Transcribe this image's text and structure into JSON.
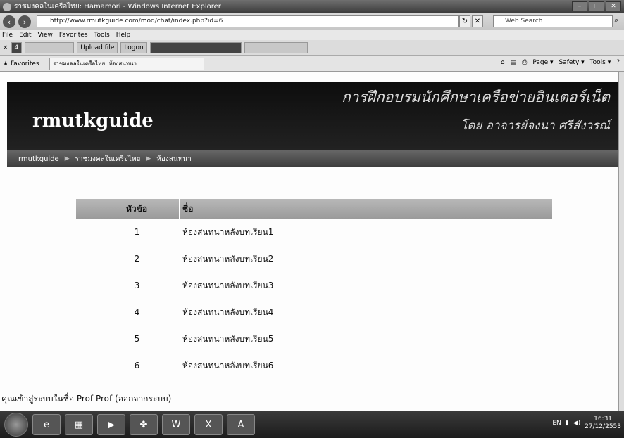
{
  "window": {
    "title": "ราชมงคลในเครือไทย: Hamamori - Windows Internet Explorer",
    "buttons": [
      "–",
      "□",
      "✕"
    ]
  },
  "address": {
    "url": "http://www.rmutkguide.com/mod/chat/index.php?id=6",
    "search_placeholder": "Web Search"
  },
  "menu": [
    "File",
    "Edit",
    "View",
    "Favorites",
    "Tools",
    "Help"
  ],
  "toolbar": {
    "counter": "4",
    "items": [
      "Upload file",
      "Logon"
    ]
  },
  "favorites": {
    "label": "Favorites",
    "tab": "ราชมงคลในเครือไทย: ห้องสนทนา",
    "commands": [
      "Page ▾",
      "Safety ▾",
      "Tools ▾"
    ]
  },
  "banner": {
    "logo": "rmutkguide",
    "heading": "การฝึกอบรมนักศึกษาเครือข่ายอินเตอร์เน็ต",
    "author": "โดย อาจารย์จงนา ศรีสังวรณ์"
  },
  "breadcrumb": [
    "rmutkguide",
    "ราชมงคลในเครือไทย",
    "ห้องสนทนา"
  ],
  "table": {
    "headers": {
      "num": "หัวข้อ",
      "name": "ชื่อ"
    },
    "rows": [
      {
        "num": "1",
        "name": "ห้องสนทนาหลังบทเรียน1"
      },
      {
        "num": "2",
        "name": "ห้องสนทนาหลังบทเรียน2"
      },
      {
        "num": "3",
        "name": "ห้องสนทนาหลังบทเรียน3"
      },
      {
        "num": "4",
        "name": "ห้องสนทนาหลังบทเรียน4"
      },
      {
        "num": "5",
        "name": "ห้องสนทนาหลังบทเรียน5"
      },
      {
        "num": "6",
        "name": "ห้องสนทนาหลังบทเรียน6"
      }
    ]
  },
  "login": {
    "prefix": "คุณเข้าสู่ระบบในชื่อ Prof Prof",
    "logout": "(ออกจากระบบ)"
  },
  "taskbar": {
    "lang": "EN",
    "time": "16:31",
    "date": "27/12/2553"
  }
}
